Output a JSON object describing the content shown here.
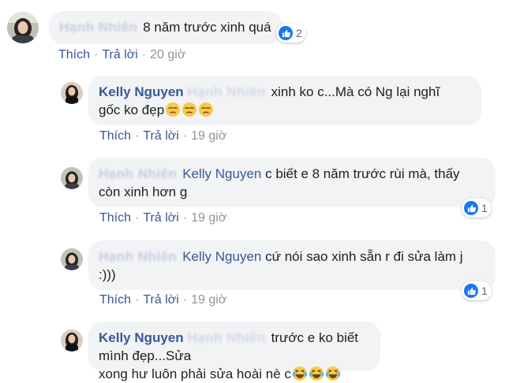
{
  "comments": [
    {
      "blurred_name": "Hạnh Nhiên",
      "text": "8 năm trước xinh quá",
      "reaction_count": "2",
      "actions": {
        "like": "Thích",
        "reply": "Trả lời",
        "time": "20 giờ"
      }
    },
    {
      "author": "Kelly Nguyen",
      "blurred_tag": "Hạnh Nhiên",
      "text_line1": "xinh ko c...Mà có Ng lại nghĩ",
      "text_line2": "gốc ko đẹp",
      "emojis": [
        "unamused-face-emoji",
        "unamused-face-emoji",
        "unamused-face-emoji"
      ],
      "actions": {
        "like": "Thích",
        "reply": "Trả lời",
        "time": "19 giờ"
      }
    },
    {
      "blurred_name": "Hạnh Nhiên",
      "tag": "Kelly Nguyen",
      "text_line1": "c biết e 8 năm trước rùi mà, thấy",
      "text_line2": "còn xinh hơn g",
      "reaction_count": "1",
      "actions": {
        "like": "Thích",
        "reply": "Trả lời",
        "time": "19 giờ"
      }
    },
    {
      "blurred_name": "Hạnh Nhiên",
      "tag": "Kelly Nguyen",
      "text_line1": "cứ nói sao xinh sẵn r đi sửa làm j",
      "text_line2": ":)))",
      "reaction_count": "1",
      "actions": {
        "like": "Thích",
        "reply": "Trả lời",
        "time": "19 giờ"
      }
    },
    {
      "author": "Kelly Nguyen",
      "blurred_tag": "Hạnh Nhiên",
      "text_line1": "trước e ko biết mình đẹp...Sửa",
      "text_line2": "xong hư luôn phải sửa hoài nè c",
      "emojis": [
        "tears-of-joy-emoji",
        "tears-of-joy-emoji",
        "tears-of-joy-emoji"
      ]
    }
  ],
  "colors": {
    "bubble": "#f2f3f5",
    "link": "#385898",
    "like_blue": "#1877f2",
    "muted": "#90949c"
  }
}
